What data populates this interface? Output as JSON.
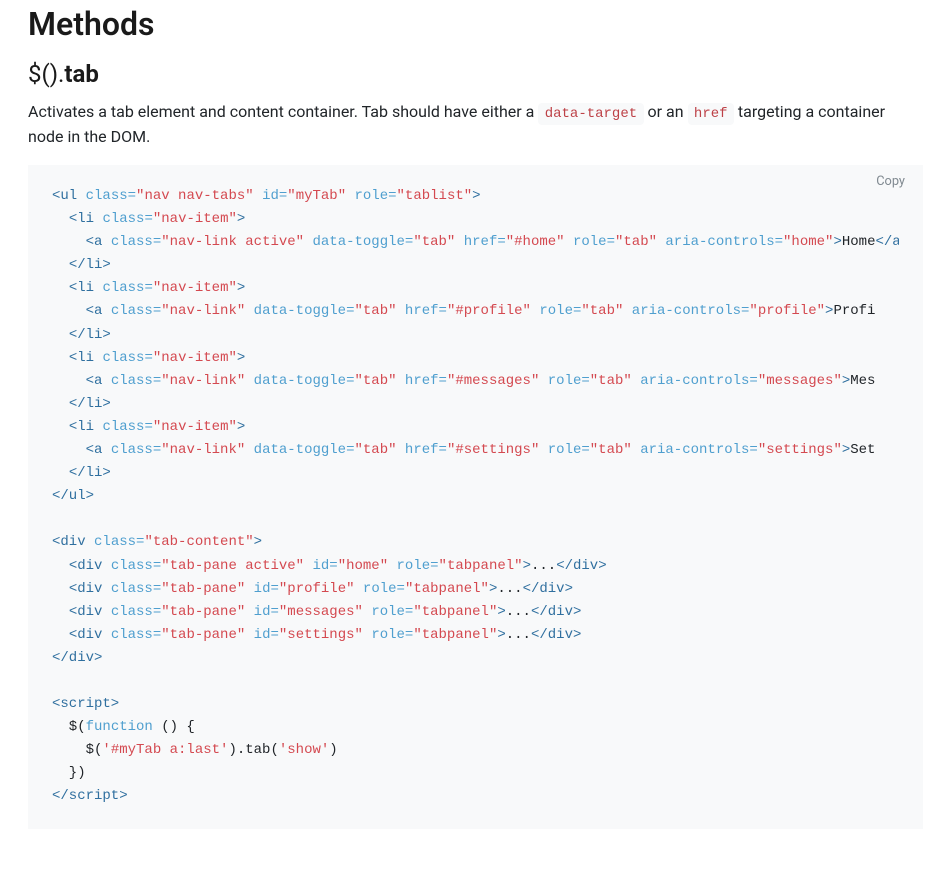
{
  "section": {
    "title": "Methods",
    "method_prefix": "$().",
    "method_name": "tab"
  },
  "description": {
    "text_1": "Activates a tab element and content container. Tab should have either a ",
    "code_1": "data-target",
    "text_2": " or an ",
    "code_2": "href",
    "text_3": " targeting a container node in the DOM."
  },
  "codeblock": {
    "copy_label": "Copy",
    "tags": {
      "ul_open": "<ul",
      "ul_close": "</ul>",
      "li_open": "<li",
      "li_close": "</li>",
      "a_open": "<a",
      "a_close": "</a>",
      "div_open": "<div",
      "div_close": "</div>",
      "script_open": "<script>",
      "script_close": "</script>",
      "angle_close": ">"
    },
    "attrs": {
      "class": "class=",
      "id": "id=",
      "role": "role=",
      "data_toggle": "data-toggle=",
      "href": "href=",
      "aria_controls": "aria-controls="
    },
    "vals": {
      "nav_nav_tabs": "\"nav nav-tabs\"",
      "myTab": "\"myTab\"",
      "tablist": "\"tablist\"",
      "nav_item": "\"nav-item\"",
      "nav_link_active": "\"nav-link active\"",
      "nav_link": "\"nav-link\"",
      "tab": "\"tab\"",
      "href_home": "\"#home\"",
      "href_profile": "\"#profile\"",
      "href_messages": "\"#messages\"",
      "href_settings": "\"#settings\"",
      "ac_home": "\"home\"",
      "ac_profile": "\"profile\"",
      "ac_messages": "\"messages\"",
      "ac_settings": "\"settings\"",
      "tab_content": "\"tab-content\"",
      "tab_pane_active": "\"tab-pane active\"",
      "tab_pane": "\"tab-pane\"",
      "id_home": "\"home\"",
      "id_profile": "\"profile\"",
      "id_messages": "\"messages\"",
      "id_settings": "\"settings\"",
      "tabpanel": "\"tabpanel\""
    },
    "text": {
      "home": "Home",
      "profile": "Profi",
      "messages": "Mes",
      "settings": "Set",
      "ellipsis": "..."
    },
    "script": {
      "line1a": "  $(",
      "line1b": "function",
      "line1c": " () {",
      "line2a": "    $(",
      "line2b": "'#myTab a:last'",
      "line2c": ").tab(",
      "line2d": "'show'",
      "line2e": ")",
      "line3": "  })"
    }
  }
}
